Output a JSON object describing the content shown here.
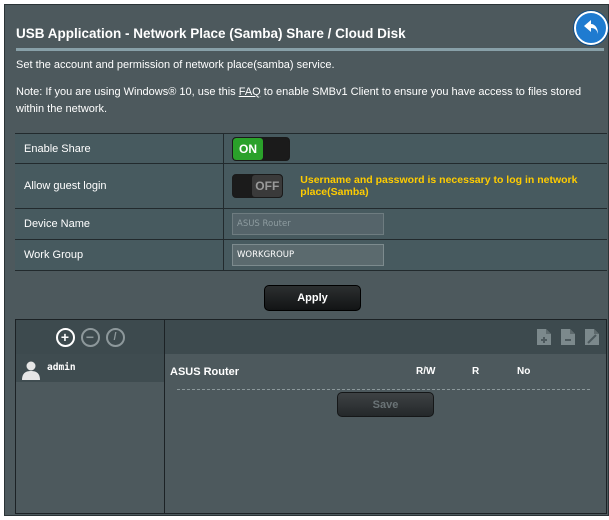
{
  "header": {
    "title": "USB Application - Network Place (Samba) Share / Cloud Disk"
  },
  "description": {
    "line1": "Set the account and permission of network place(samba) service.",
    "note_before": "Note: If you are using Windows® 10, use this ",
    "note_link": "FAQ",
    "note_after": " to enable SMBv1 Client to ensure you have access to files stored within the network."
  },
  "form": {
    "enable_share": {
      "label": "Enable Share",
      "state_label": "ON",
      "enabled": true
    },
    "guest_login": {
      "label": "Allow guest login",
      "state_label": "OFF",
      "enabled": false,
      "warning": "Username and password is necessary to log in network place(Samba)"
    },
    "device_name": {
      "label": "Device Name",
      "value": "ASUS Router"
    },
    "work_group": {
      "label": "Work Group",
      "value": "WORKGROUP"
    }
  },
  "apply_label": "Apply",
  "accounts": {
    "items": [
      {
        "name": "admin"
      }
    ]
  },
  "permissions": {
    "device": "ASUS Router",
    "columns": {
      "rw": "R/W",
      "r": "R",
      "no": "No"
    }
  },
  "save_label": "Save"
}
